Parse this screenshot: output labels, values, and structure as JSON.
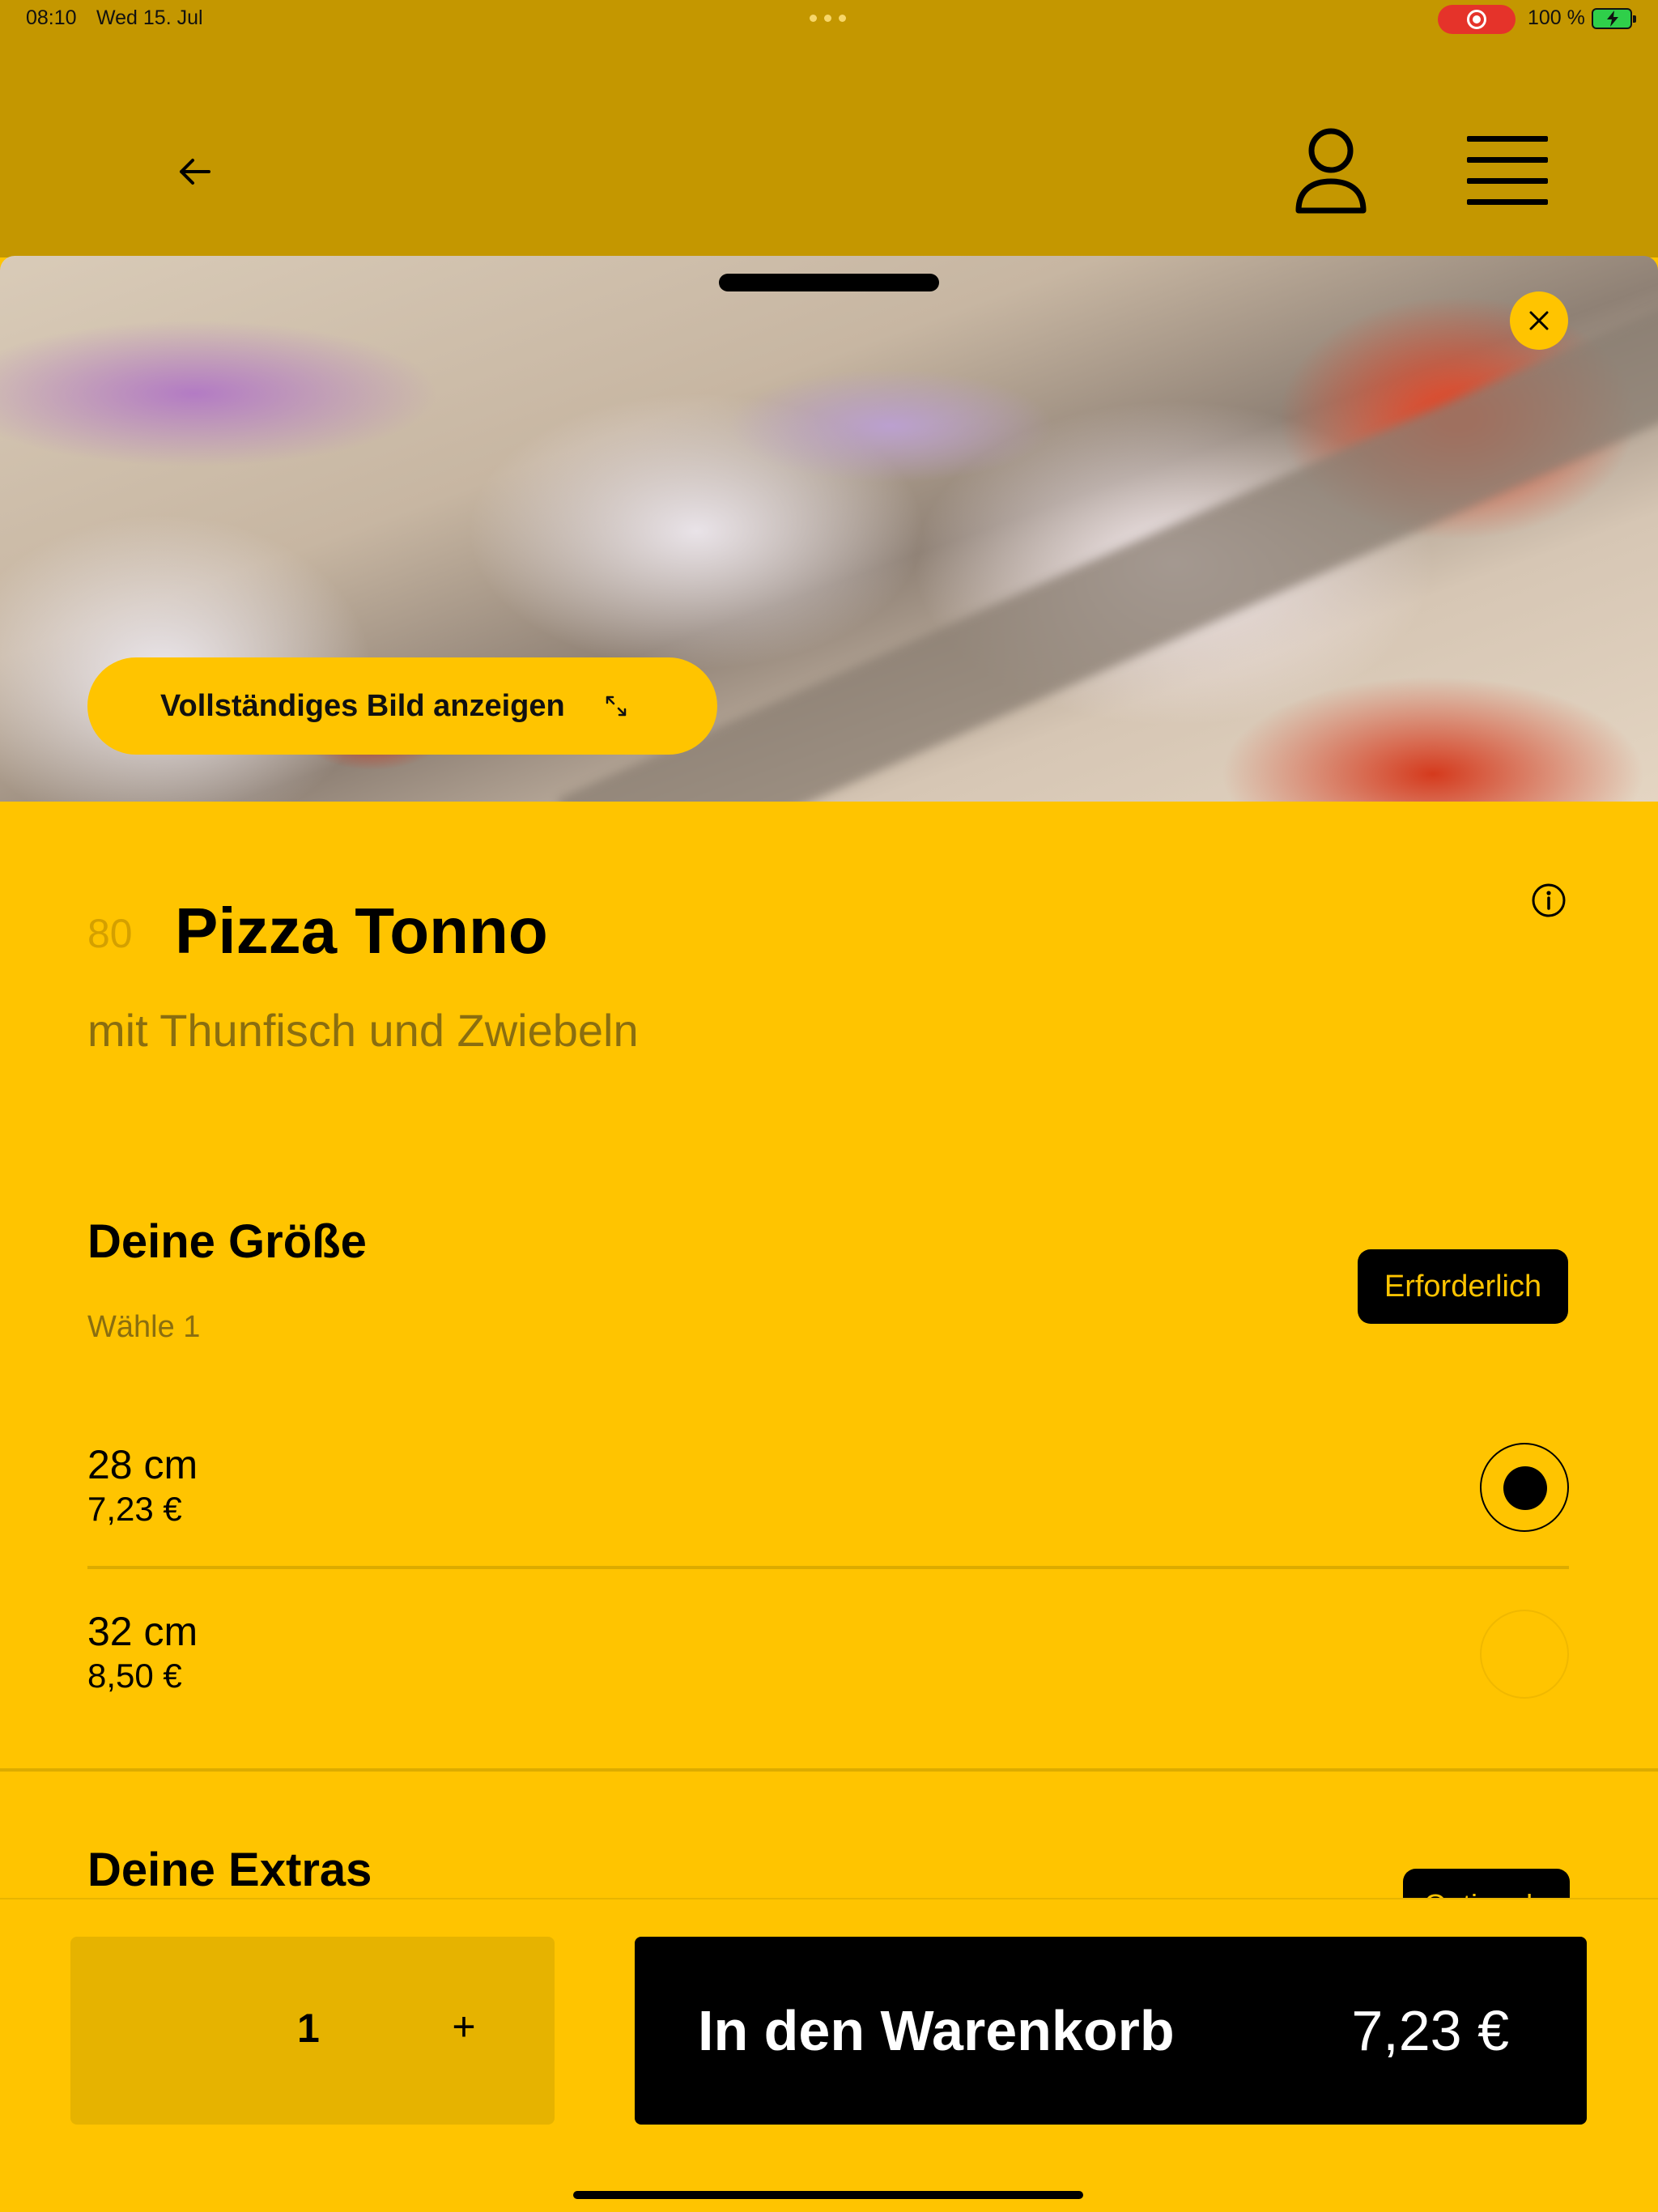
{
  "status_bar": {
    "time": "08:10",
    "date": "Wed 15. Jul",
    "battery": "100 %"
  },
  "colors": {
    "header_bg": "#c49700",
    "page_bg": "#ffc400",
    "accent_black": "#000000"
  },
  "header": {
    "back_icon": "arrow-left-icon",
    "profile_icon": "user-icon",
    "menu_icon": "hamburger-menu-icon"
  },
  "hero": {
    "full_image_label": "Vollständiges Bild anzeigen",
    "expand_icon": "expand-arrows-icon",
    "close_icon": "close-icon"
  },
  "product": {
    "number": "80",
    "name": "Pizza Tonno",
    "description": "mit Thunfisch und Zwiebeln"
  },
  "size_section": {
    "title": "Deine Größe",
    "subtitle": "Wähle 1",
    "badge": "Erforderlich",
    "options": [
      {
        "label": "28 cm",
        "price": "7,23 €",
        "selected": true
      },
      {
        "label": "32 cm",
        "price": "8,50 €",
        "selected": false
      }
    ]
  },
  "extras_section": {
    "title": "Deine Extras",
    "badge": "Optional"
  },
  "action_bar": {
    "quantity": "1",
    "plus_label": "+",
    "cart_label": "In den Warenkorb",
    "cart_price": "7,23 €"
  }
}
